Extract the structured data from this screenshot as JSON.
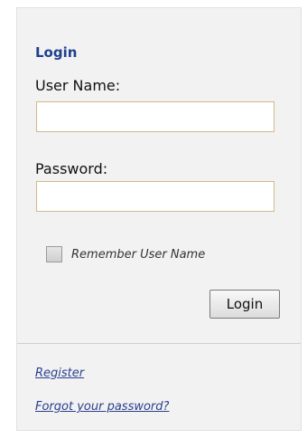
{
  "login": {
    "title": "Login",
    "username_label": "User Name:",
    "username_value": "",
    "password_label": "Password:",
    "password_value": "",
    "remember_label": "Remember User Name",
    "remember_checked": false,
    "button_label": "Login"
  },
  "links": {
    "register": "Register",
    "forgot": "Forgot your password?"
  },
  "colors": {
    "title": "#1f3f8f",
    "link": "#2a3f8f",
    "panel_background": "#f2f2f2",
    "input_border": "#d3b88c"
  }
}
